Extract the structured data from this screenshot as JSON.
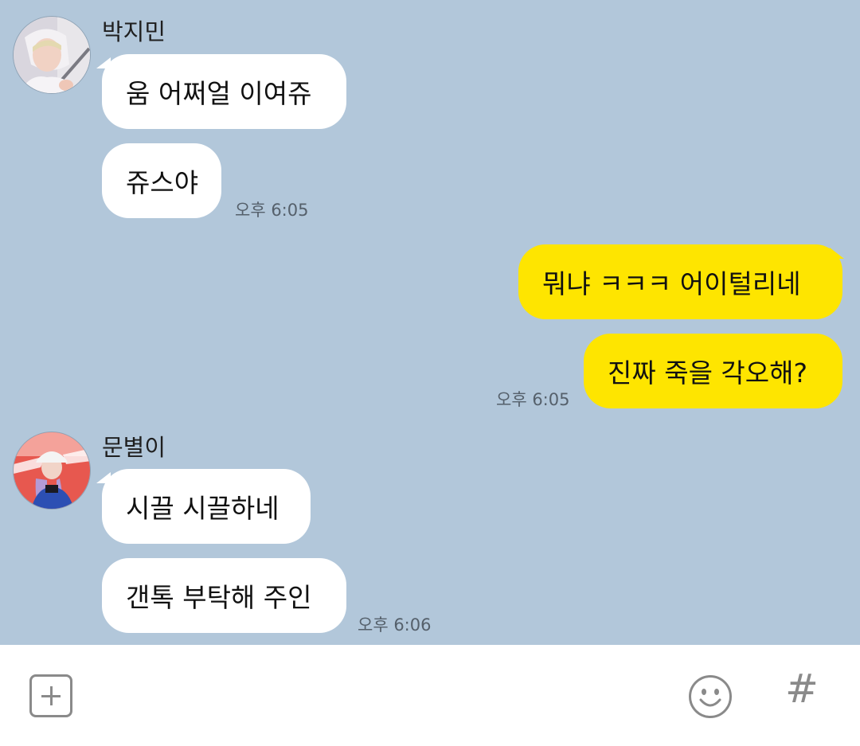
{
  "conversation": [
    {
      "sender": "박지민",
      "messages": [
        "움 어쩌얼 이여쥬",
        "쥬스야"
      ],
      "time": "오후 6:05"
    },
    {
      "sender": "me",
      "messages": [
        "뭐냐 ㅋㅋㅋ 어이털리네",
        "진짜 죽을 각오해?"
      ],
      "time": "오후 6:05"
    },
    {
      "sender": "문별이",
      "messages": [
        "시끌 시끌하네",
        "갠톡 부탁해 주인"
      ],
      "time": "오후 6:06"
    }
  ],
  "input_bar": {
    "attach_icon": "plus-square-icon",
    "emoji_icon": "smiley-icon",
    "hashtag_label": "#"
  },
  "colors": {
    "background": "#b2c7da",
    "incoming_bubble": "#ffffff",
    "outgoing_bubble": "#fee500"
  }
}
